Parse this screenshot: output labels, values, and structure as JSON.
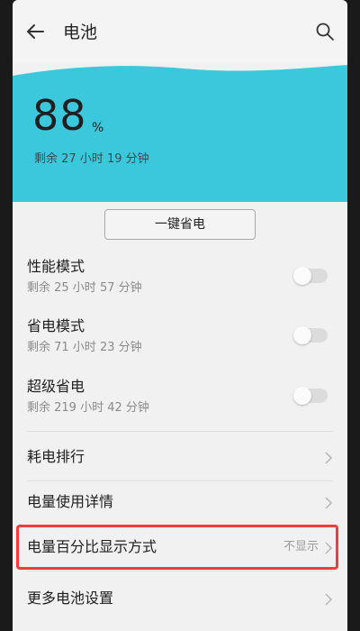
{
  "header": {
    "title": "电池",
    "back_icon": "arrow-left-icon",
    "search_icon": "search-icon"
  },
  "battery": {
    "percent": "88",
    "unit": "%",
    "remaining": "剩余 27 小时 19 分钟",
    "wave_color": "#3cc8dc"
  },
  "one_key_button": {
    "label": "一键省电"
  },
  "modes": [
    {
      "title": "性能模式",
      "subtitle": "剩余 25 小时 57 分钟",
      "enabled": false
    },
    {
      "title": "省电模式",
      "subtitle": "剩余 71 小时 23 分钟",
      "enabled": false
    },
    {
      "title": "超级省电",
      "subtitle": "剩余 219 小时 42 分钟",
      "enabled": false
    }
  ],
  "list": [
    {
      "label": "耗电排行",
      "value": ""
    },
    {
      "label": "电量使用详情",
      "value": ""
    },
    {
      "label": "电量百分比显示方式",
      "value": "不显示"
    },
    {
      "label": "更多电池设置",
      "value": ""
    }
  ],
  "colors": {
    "highlight": "#f23c3c",
    "accent": "#3cc8dc"
  }
}
